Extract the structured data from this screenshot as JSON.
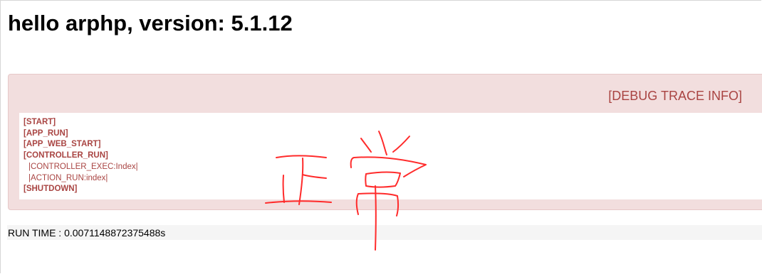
{
  "page": {
    "title": "hello arphp, version: 5.1.12"
  },
  "debug": {
    "header": "[DEBUG TRACE INFO]",
    "trace": [
      "[START]",
      "[APP_RUN]",
      "[APP_WEB_START]",
      "[CONTROLLER_RUN]",
      "|CONTROLLER_EXEC:Index|",
      "|ACTION_RUN:index|",
      "[SHUTDOWN]"
    ]
  },
  "footer": {
    "run_time": "RUN TIME : 0.0071148872375488s"
  },
  "annotation": {
    "handwritten_text": "正常",
    "color": "#ff2b2b"
  }
}
